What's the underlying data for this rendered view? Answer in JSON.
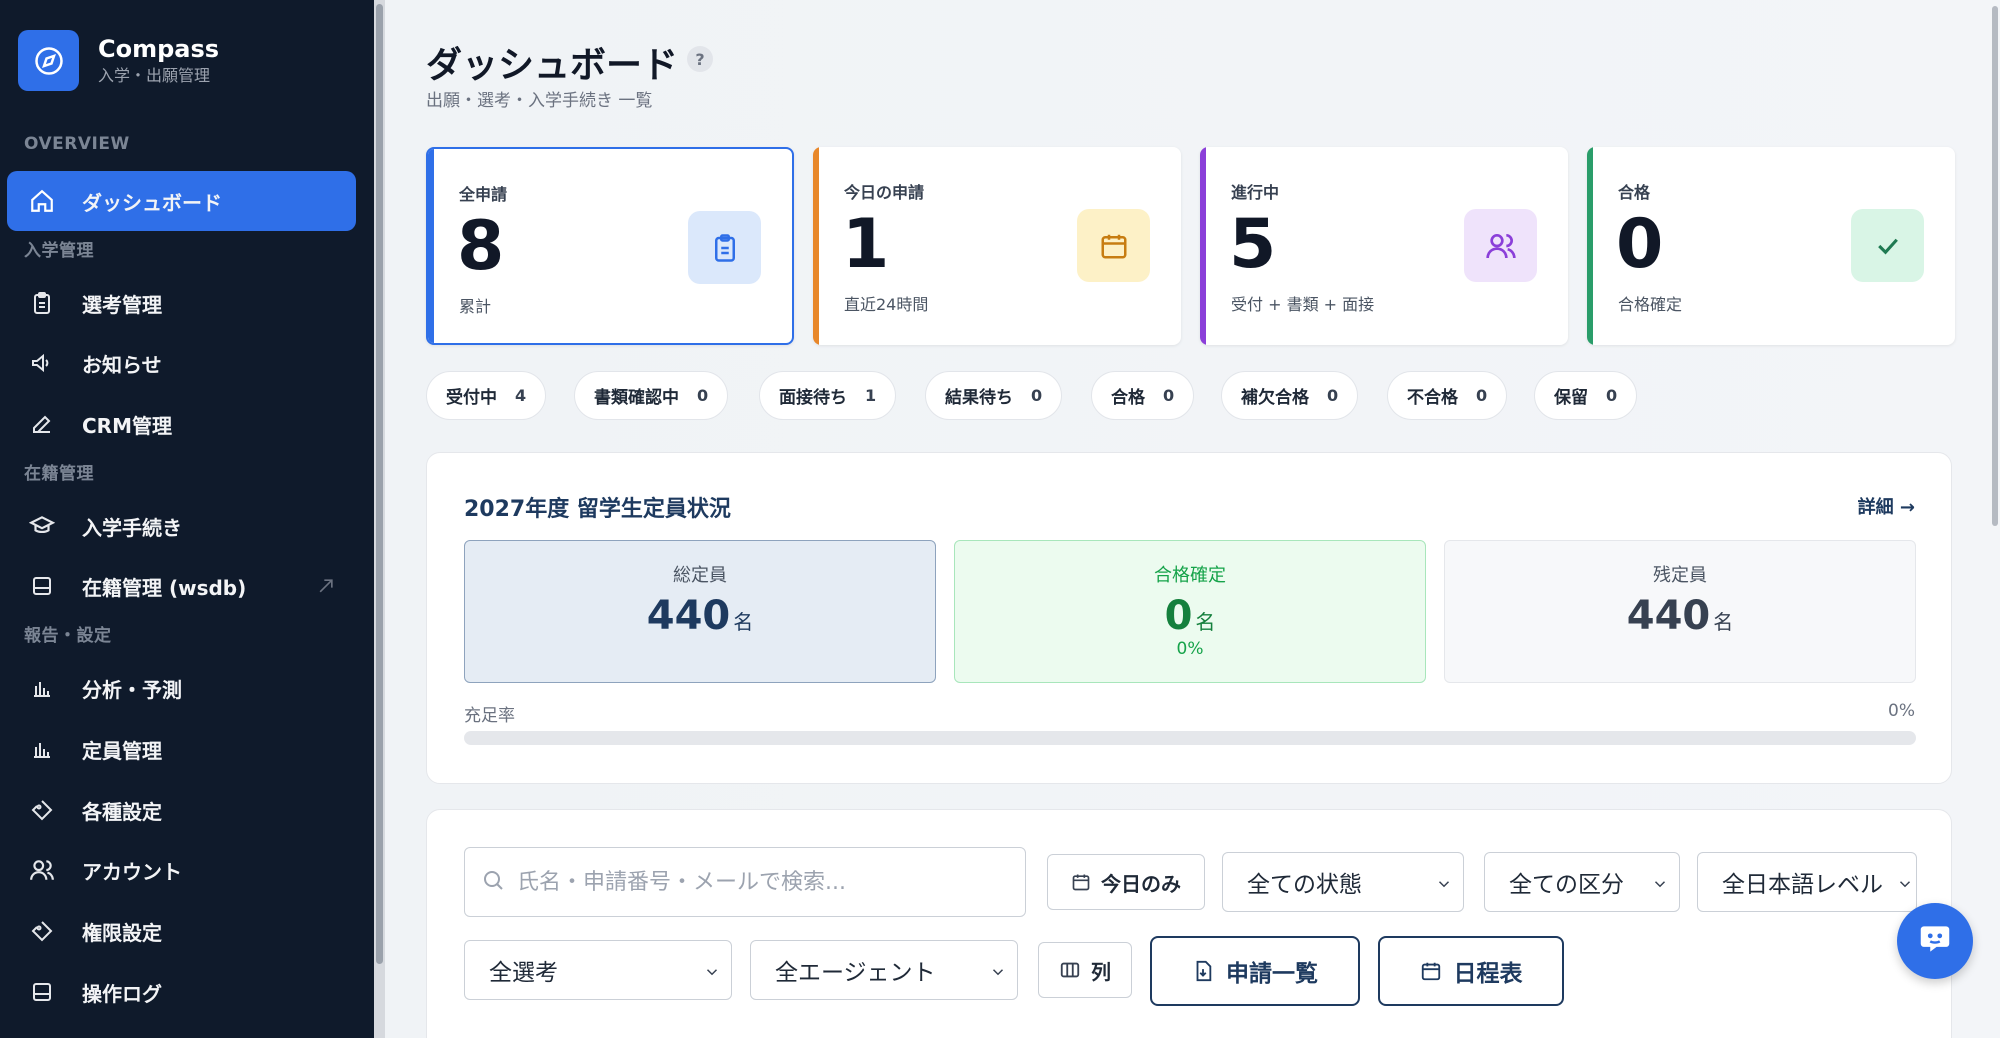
{
  "app": {
    "name": "Compass",
    "subtitle": "入学・出願管理"
  },
  "sidebar": {
    "sections": {
      "overview": "OVERVIEW",
      "admissions": "入学管理",
      "enrollment": "在籍管理",
      "reports": "報告・設定"
    },
    "items": [
      {
        "label": "ダッシュボード",
        "icon": "home-icon",
        "active": true
      },
      {
        "label": "選考管理",
        "icon": "clipboard-icon"
      },
      {
        "label": "お知らせ",
        "icon": "megaphone-icon"
      },
      {
        "label": "CRM管理",
        "icon": "edit-icon"
      },
      {
        "label": "入学手続き",
        "icon": "graduation-cap-icon"
      },
      {
        "label": "在籍管理 (wsdb)",
        "icon": "database-icon",
        "external": true
      },
      {
        "label": "分析・予測",
        "icon": "bar-chart-icon"
      },
      {
        "label": "定員管理",
        "icon": "bar-chart-icon"
      },
      {
        "label": "各種設定",
        "icon": "tag-icon"
      },
      {
        "label": "アカウント",
        "icon": "users-icon"
      },
      {
        "label": "権限設定",
        "icon": "tag-icon"
      },
      {
        "label": "操作ログ",
        "icon": "log-icon"
      }
    ]
  },
  "header": {
    "title": "ダッシュボード",
    "help": "?",
    "subtitle": "出願・選考・入学手続き 一覧"
  },
  "stats": [
    {
      "title": "全申請",
      "value": "8",
      "sub": "累計",
      "accent": "#2f6fe8",
      "icon": "clipboard-icon"
    },
    {
      "title": "今日の申請",
      "value": "1",
      "sub": "直近24時間",
      "accent": "#e8872a",
      "icon": "calendar-icon"
    },
    {
      "title": "進行中",
      "value": "5",
      "sub": "受付 + 書類 + 面接",
      "accent": "#8b3fd9",
      "icon": "users-icon"
    },
    {
      "title": "合格",
      "value": "0",
      "sub": "合格確定",
      "accent": "#2a9d6a",
      "icon": "check-icon"
    }
  ],
  "status_pills": [
    {
      "label": "受付中",
      "count": "4"
    },
    {
      "label": "書類確認中",
      "count": "0"
    },
    {
      "label": "面接待ち",
      "count": "1"
    },
    {
      "label": "結果待ち",
      "count": "0"
    },
    {
      "label": "合格",
      "count": "0"
    },
    {
      "label": "補欠合格",
      "count": "0"
    },
    {
      "label": "不合格",
      "count": "0"
    },
    {
      "label": "保留",
      "count": "0"
    }
  ],
  "capacity": {
    "title": "2027年度 留学生定員状況",
    "detail_link": "詳細 →",
    "total": {
      "label": "総定員",
      "value": "440",
      "unit": "名"
    },
    "confirmed": {
      "label": "合格確定",
      "value": "0",
      "unit": "名",
      "percent": "0%"
    },
    "remaining": {
      "label": "残定員",
      "value": "440",
      "unit": "名"
    },
    "fill_label": "充足率",
    "fill_value": "0%",
    "fill_fraction": 0
  },
  "filters": {
    "search_placeholder": "氏名・申請番号・メールで検索...",
    "today_only": "今日のみ",
    "status_select": "全ての状態",
    "category_select": "全ての区分",
    "japanese_level_select": "全日本語レベル",
    "selection_select": "全選考",
    "agent_select": "全エージェント",
    "columns_button": "列",
    "application_list_button": "申請一覧",
    "schedule_button": "日程表"
  }
}
